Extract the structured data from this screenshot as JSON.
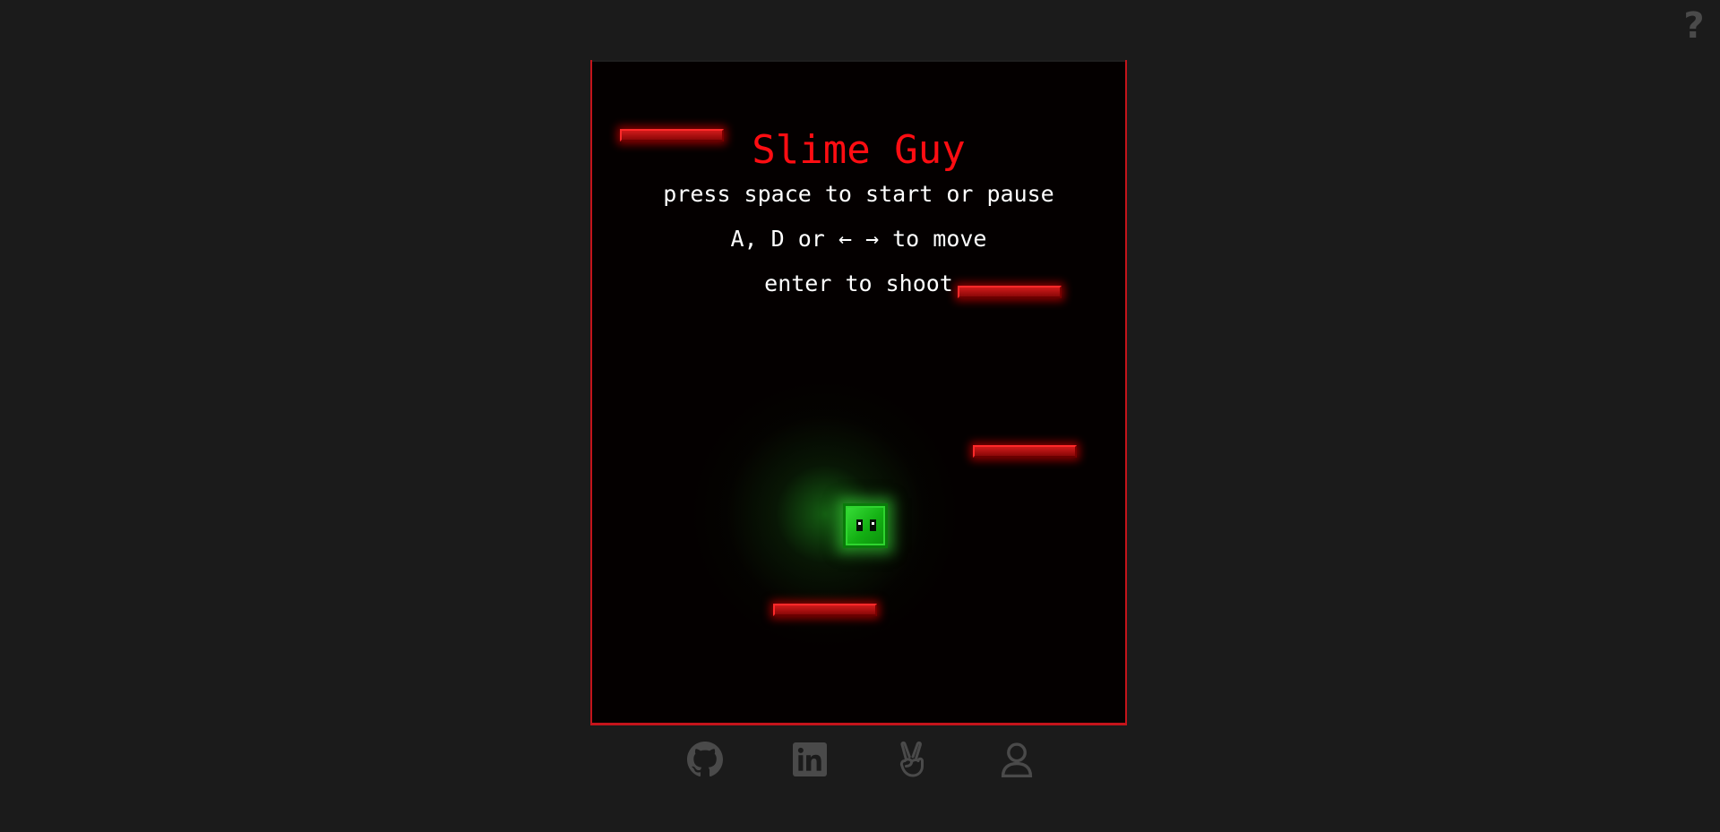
{
  "help": {
    "icon_glyph": "?",
    "icon": "question-mark-icon"
  },
  "game": {
    "title": "Slime Guy",
    "instructions": [
      "press space to start or pause",
      "A, D or ← → to move",
      "enter to shoot"
    ],
    "player": "slime",
    "platform_count": 4
  },
  "social_links": [
    {
      "name": "github",
      "icon": "github-icon"
    },
    {
      "name": "linkedin",
      "icon": "linkedin-icon"
    },
    {
      "name": "angellist",
      "icon": "peace-hand-icon"
    },
    {
      "name": "profile",
      "icon": "user-icon"
    }
  ],
  "colors": {
    "background": "#1b1b1b",
    "canvas": "#040000",
    "accent_red": "#ff0d12",
    "platform_red": "#d01a1a",
    "slime_green": "#13b013",
    "icon_gray": "#4a4a4a"
  }
}
